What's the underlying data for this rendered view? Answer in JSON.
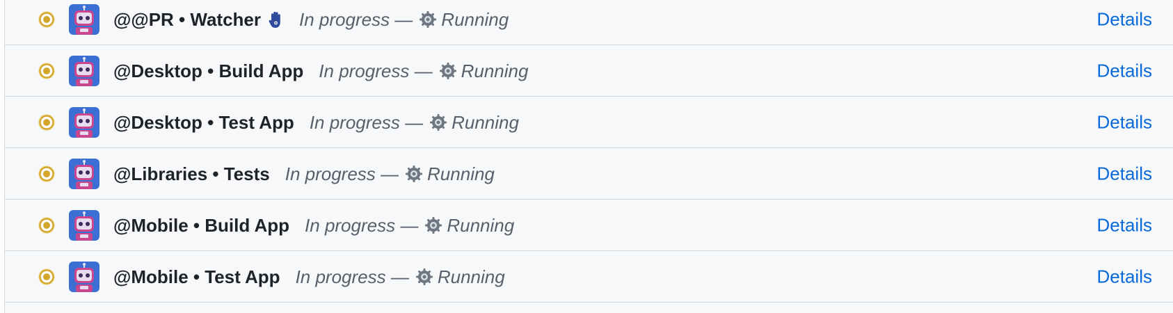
{
  "checks": [
    {
      "name": "@@PR • Watcher",
      "extra_icon": "hand-icon",
      "status_text": "In progress —",
      "state_text": "Running",
      "details_label": "Details"
    },
    {
      "name": "@Desktop • Build App",
      "status_text": "In progress —",
      "state_text": "Running",
      "details_label": "Details"
    },
    {
      "name": "@Desktop • Test App",
      "status_text": "In progress —",
      "state_text": "Running",
      "details_label": "Details"
    },
    {
      "name": "@Libraries • Tests",
      "status_text": "In progress —",
      "state_text": "Running",
      "details_label": "Details"
    },
    {
      "name": "@Mobile • Build App",
      "status_text": "In progress —",
      "state_text": "Running",
      "details_label": "Details"
    },
    {
      "name": "@Mobile • Test App",
      "status_text": "In progress —",
      "state_text": "Running",
      "details_label": "Details"
    }
  ],
  "colors": {
    "status_pending": "#d4a72c",
    "link": "#0969da",
    "avatar_bg": "#3b6fd4",
    "robot_body": "#c9468e"
  }
}
